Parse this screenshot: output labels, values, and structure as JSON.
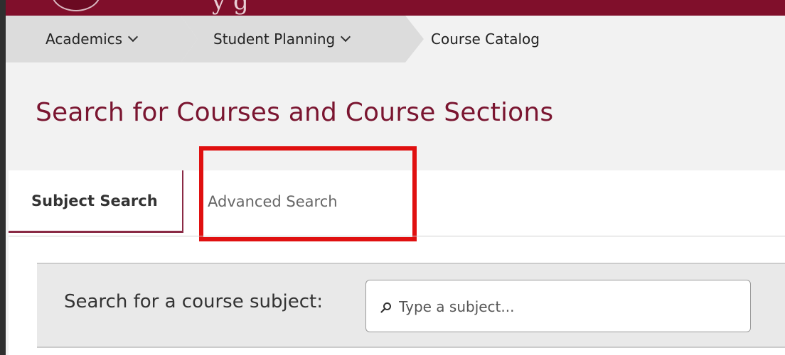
{
  "header": {
    "logo_text": "y g"
  },
  "breadcrumb": {
    "items": [
      {
        "label": "Academics"
      },
      {
        "label": "Student Planning"
      },
      {
        "label": "Course Catalog"
      }
    ]
  },
  "page": {
    "title": "Search for Courses and Course Sections"
  },
  "tabs": [
    {
      "label": "Subject Search",
      "active": true
    },
    {
      "label": "Advanced Search",
      "active": false
    }
  ],
  "search": {
    "label": "Search for a course subject:",
    "placeholder": "Type a subject...",
    "value": ""
  },
  "colors": {
    "brand": "#800f2b",
    "title": "#7a1530",
    "highlight": "#e01010"
  },
  "icons": {
    "search": "search-icon",
    "chevron": "chevron-down-icon"
  }
}
